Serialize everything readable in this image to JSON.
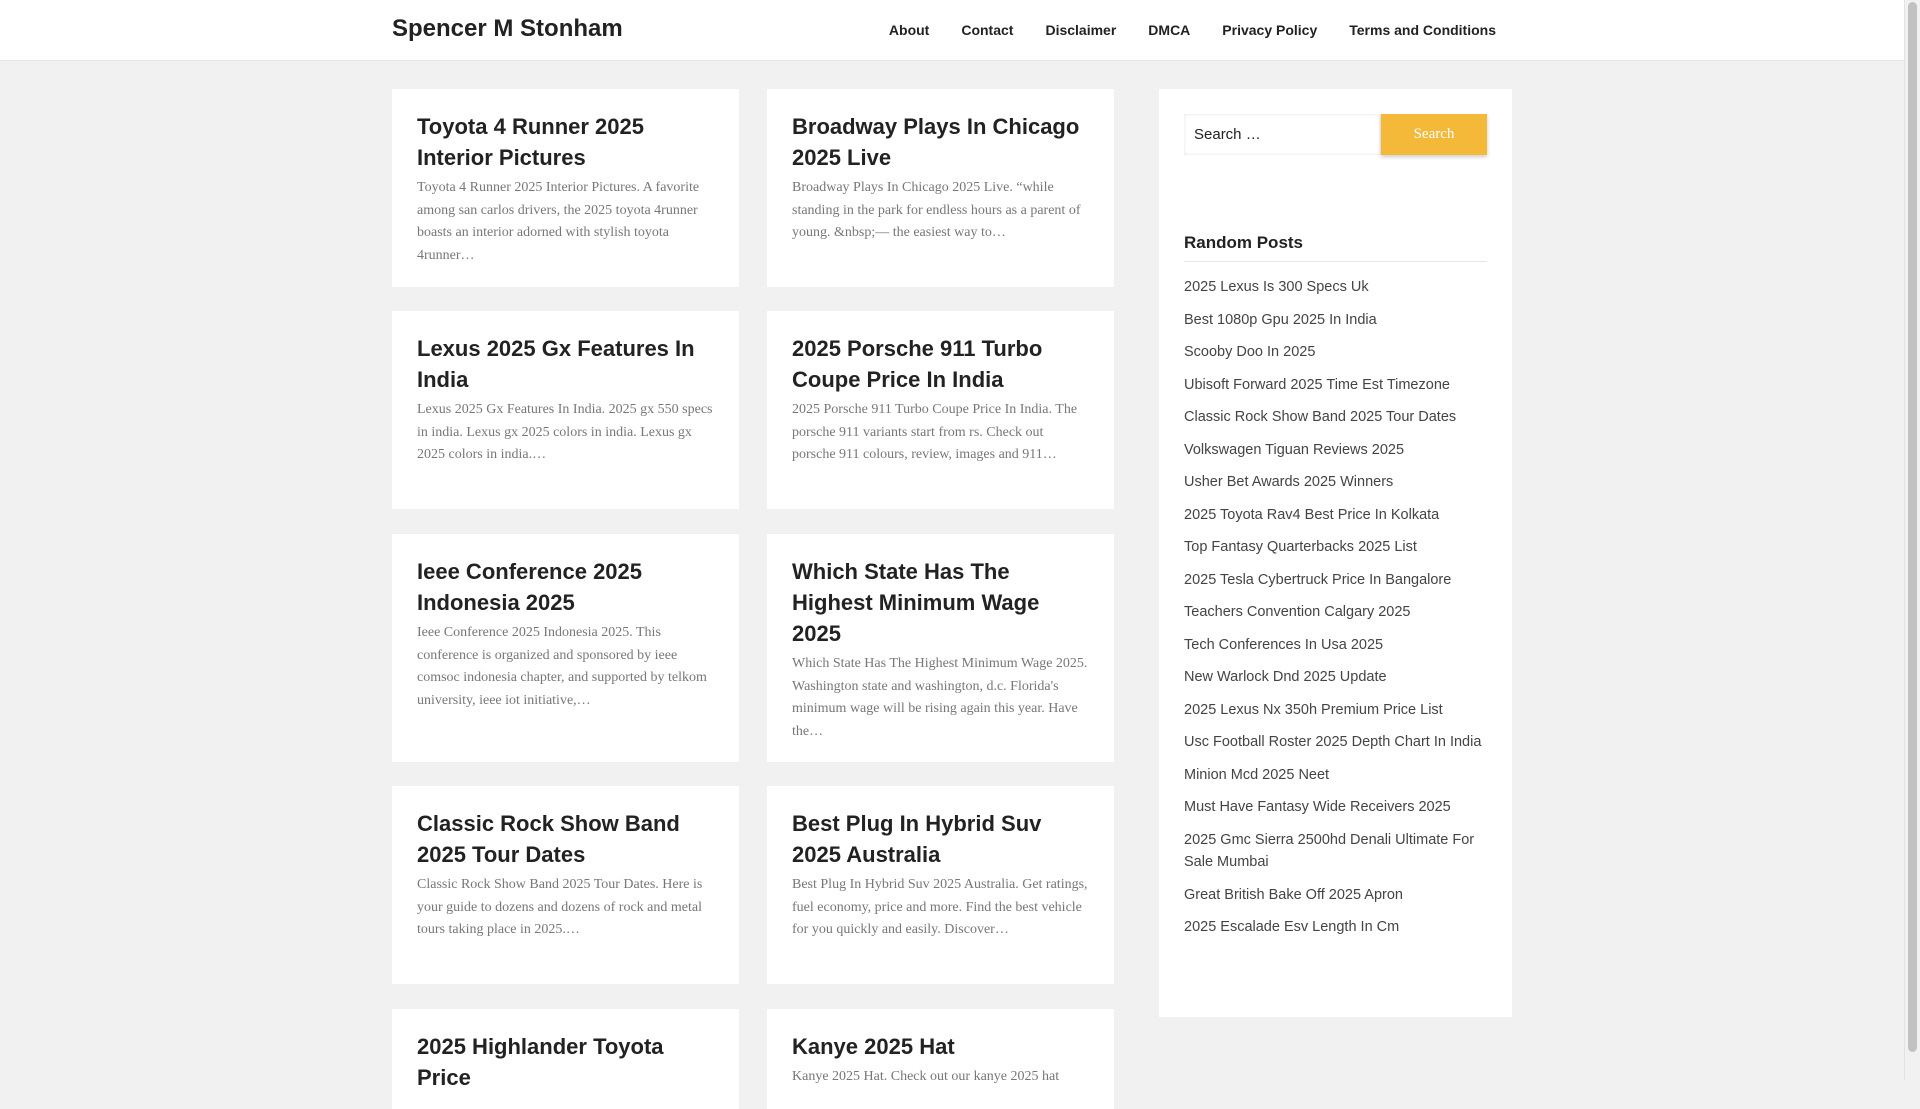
{
  "site": {
    "title": "Spencer M Stonham"
  },
  "nav": [
    {
      "label": "About"
    },
    {
      "label": "Contact"
    },
    {
      "label": "Disclaimer"
    },
    {
      "label": "DMCA"
    },
    {
      "label": "Privacy Policy"
    },
    {
      "label": "Terms and Conditions"
    }
  ],
  "posts": [
    {
      "title": "Toyota 4 Runner 2025 Interior Pictures",
      "excerpt": "Toyota 4 Runner 2025 Interior Pictures. A favorite among san carlos drivers, the 2025 toyota 4runner boasts an interior adorned with stylish toyota 4runner…"
    },
    {
      "title": "Broadway Plays In Chicago 2025 Live",
      "excerpt": "Broadway Plays In Chicago 2025 Live. “while standing in the park for endless hours as a parent of young. &nbsp;— the easiest way to…"
    },
    {
      "title": "Lexus 2025 Gx Features In India",
      "excerpt": "Lexus 2025 Gx Features In India. 2025 gx 550 specs in india. Lexus gx 2025 colors in india. Lexus gx 2025 colors in india.…"
    },
    {
      "title": "2025 Porsche 911 Turbo Coupe Price In India",
      "excerpt": "2025 Porsche 911 Turbo Coupe Price In India. The porsche 911 variants start from rs. Check out porsche 911 colours, review, images and 911…"
    },
    {
      "title": "Ieee Conference 2025 Indonesia 2025",
      "excerpt": "Ieee Conference 2025 Indonesia 2025. This conference is organized and sponsored by ieee comsoc indonesia chapter, and supported by telkom university, ieee iot initiative,…"
    },
    {
      "title": "Which State Has The Highest Minimum Wage 2025",
      "excerpt": "Which State Has The Highest Minimum Wage 2025. Washington state and washington, d.c. Florida's minimum wage will be rising again this year. Have the…"
    },
    {
      "title": "Classic Rock Show Band 2025 Tour Dates",
      "excerpt": "Classic Rock Show Band 2025 Tour Dates. Here is your guide to dozens and dozens of rock and metal tours taking place in 2025.…"
    },
    {
      "title": "Best Plug In Hybrid Suv 2025 Australia",
      "excerpt": "Best Plug In Hybrid Suv 2025 Australia. Get ratings, fuel economy, price and more. Find the best vehicle for you quickly and easily. Discover…"
    },
    {
      "title": "2025 Highlander Toyota Price",
      "excerpt": ""
    },
    {
      "title": "Kanye 2025 Hat",
      "excerpt": "Kanye 2025 Hat. Check out our kanye 2025 hat"
    }
  ],
  "sidebar": {
    "search": {
      "placeholder": "Search …",
      "button_label": "Search"
    },
    "random_posts_title": "Random Posts",
    "random_posts": [
      "2025 Lexus Is 300 Specs Uk",
      "Best 1080p Gpu 2025 In India",
      "Scooby Doo In 2025",
      "Ubisoft Forward 2025 Time Est Timezone",
      "Classic Rock Show Band 2025 Tour Dates",
      "Volkswagen Tiguan Reviews 2025",
      "Usher Bet Awards 2025 Winners",
      "2025 Toyota Rav4 Best Price In Kolkata",
      "Top Fantasy Quarterbacks 2025 List",
      "2025 Tesla Cybertruck Price In Bangalore",
      "Teachers Convention Calgary 2025",
      "Tech Conferences In Usa 2025",
      "New Warlock Dnd 2025 Update",
      "2025 Lexus Nx 350h Premium Price List",
      "Usc Football Roster 2025 Depth Chart In India",
      "Minion Mcd 2025 Neet",
      "Must Have Fantasy Wide Receivers 2025",
      "2025 Gmc Sierra 2500hd Denali Ultimate For Sale Mumbai",
      "Great British Bake Off 2025 Apron",
      "2025 Escalade Esv Length In Cm"
    ]
  }
}
